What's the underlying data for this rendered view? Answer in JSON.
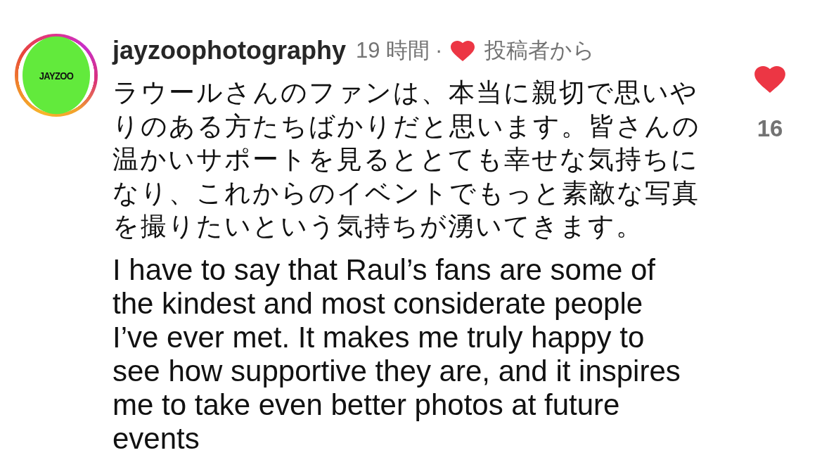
{
  "comment": {
    "avatar": {
      "label": "JAYZOO",
      "story_ring": true
    },
    "username": "jayzoophotography",
    "time": "19 時間",
    "separator": "·",
    "liked_by_author": true,
    "author_like_label": "投稿者から",
    "text_ja": "ラウールさんのファンは、本当に親切で思いやりのある方たちばかりだと思います。皆さんの温かいサポートを見るととても幸せな気持ちになり、これからのイベントでもっと素敵な写真を撮りたいという気持ちが湧いてきます。",
    "text_en": "I have to say that Raul’s fans are some of the kindest and most considerate people I’ve ever met. It makes me truly happy to see how supportive they are, and it inspires me to take even better photos at future events",
    "like": {
      "liked": true,
      "count": "16"
    }
  }
}
